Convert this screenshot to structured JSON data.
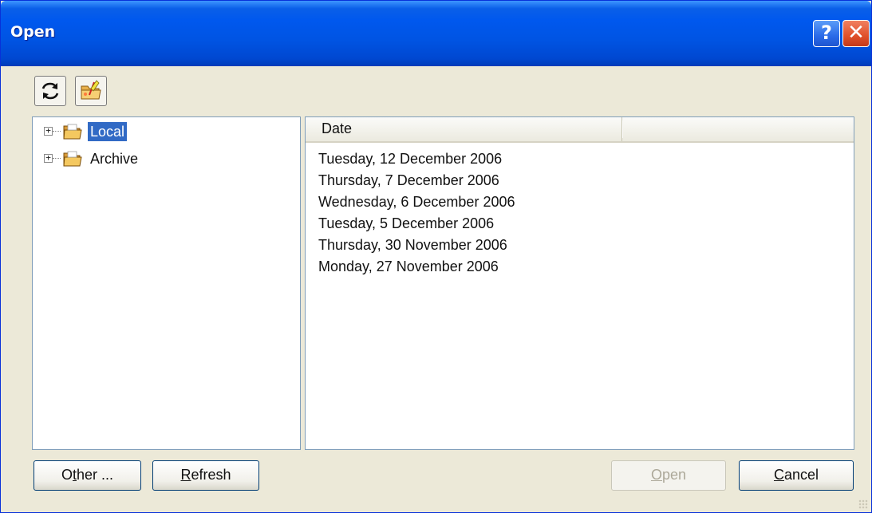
{
  "window": {
    "title": "Open"
  },
  "titlebar": {
    "help_label": "?",
    "close_label": "✕"
  },
  "toolbar": {
    "refresh_icon": "refresh-icon",
    "new_folder_icon": "new-folder-icon"
  },
  "tree": {
    "items": [
      {
        "label": "Local",
        "selected": true,
        "expander": "+"
      },
      {
        "label": "Archive",
        "selected": false,
        "expander": "+"
      }
    ]
  },
  "list": {
    "columns": [
      "Date"
    ],
    "rows": [
      "Tuesday, 12 December 2006",
      "Thursday, 7 December 2006",
      "Wednesday, 6 December 2006",
      "Tuesday, 5 December 2006",
      "Thursday, 30 November 2006",
      "Monday, 27 November 2006"
    ]
  },
  "buttons": {
    "other": {
      "label": "Other ...",
      "mnemonic_index": 1
    },
    "refresh": {
      "label": "Refresh",
      "mnemonic_index": 0
    },
    "open": {
      "label": "Open",
      "mnemonic_index": 0,
      "enabled": false
    },
    "cancel": {
      "label": "Cancel",
      "mnemonic_index": 0
    }
  },
  "colors": {
    "titlebar": "#0054e3",
    "selection": "#316ac5",
    "dialog_bg": "#ece9d8"
  }
}
